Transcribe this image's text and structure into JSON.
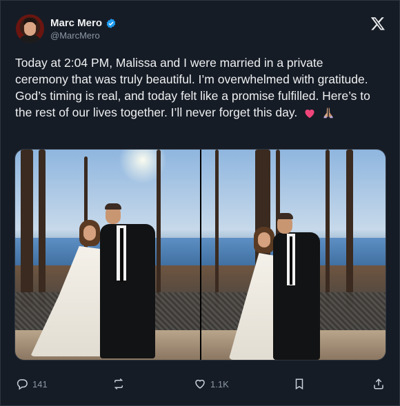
{
  "tweet": {
    "author": {
      "name": "Marc Mero",
      "handle": "@MarcMero",
      "verified": true
    },
    "text": "Today at 2:04 PM, Malissa and I were married in a private ceremony that was truly beautiful. I’m overwhelmed with gratitude. God’s timing is real, and today felt like a promise fulfilled. Here’s to the rest of our lives together. I’ll never forget this day.",
    "emojis": [
      "pink-heart",
      "folded-hands"
    ],
    "media": [
      {
        "name": "wedding-photo-1"
      },
      {
        "name": "wedding-photo-2"
      }
    ],
    "actions": {
      "replies": "141",
      "retweets": "",
      "likes": "1.1K"
    }
  },
  "icons": {
    "verified": "verified-badge-icon",
    "logo": "x-logo-icon",
    "reply": "reply-icon",
    "retweet": "retweet-icon",
    "like": "heart-icon",
    "bookmark": "bookmark-icon",
    "share": "share-icon"
  },
  "colors": {
    "background": "#161c26",
    "text": "#eef0f1",
    "muted": "#8b98a5",
    "verified": "#1d9bf0",
    "heart_emoji": "#f0457a"
  }
}
